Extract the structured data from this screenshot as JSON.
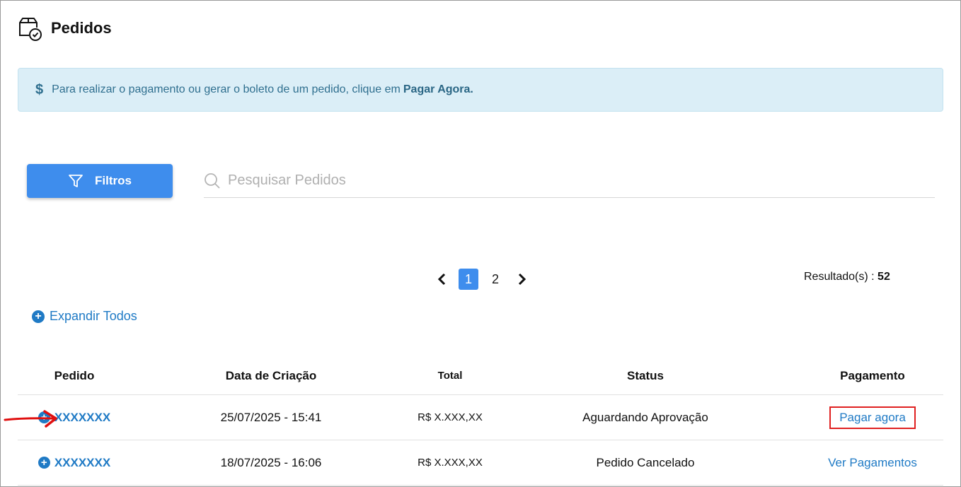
{
  "page": {
    "title": "Pedidos"
  },
  "alert": {
    "icon": "dollar-icon",
    "text": "Para realizar o pagamento ou gerar o boleto de um pedido, clique em",
    "highlight": "Pagar Agora."
  },
  "toolbar": {
    "filter_label": "Filtros",
    "search_placeholder": "Pesquisar Pedidos",
    "search_value": ""
  },
  "pagination": {
    "pages": [
      "1",
      "2"
    ],
    "current": "1",
    "results_label": "Resultado(s) :",
    "results_count": "52"
  },
  "expand_all_label": "Expandir Todos",
  "table": {
    "headers": [
      "Pedido",
      "Data de Criação",
      "Total",
      "Status",
      "Pagamento"
    ],
    "rows": [
      {
        "pedido": "XXXXXXX",
        "data": "25/07/2025 - 15:41",
        "total": "R$ X.XXX,XX",
        "status": "Aguardando Aprovação",
        "pagamento": "Pagar agora"
      },
      {
        "pedido": "XXXXXXX",
        "data": "18/07/2025 - 16:06",
        "total": "R$ X.XXX,XX",
        "status": "Pedido Cancelado",
        "pagamento": "Ver Pagamentos"
      }
    ]
  },
  "colors": {
    "accent": "#3e8ded",
    "link": "#1f7ac5",
    "alert_bg": "#dbeef7",
    "highlight_box": "#e02020"
  }
}
